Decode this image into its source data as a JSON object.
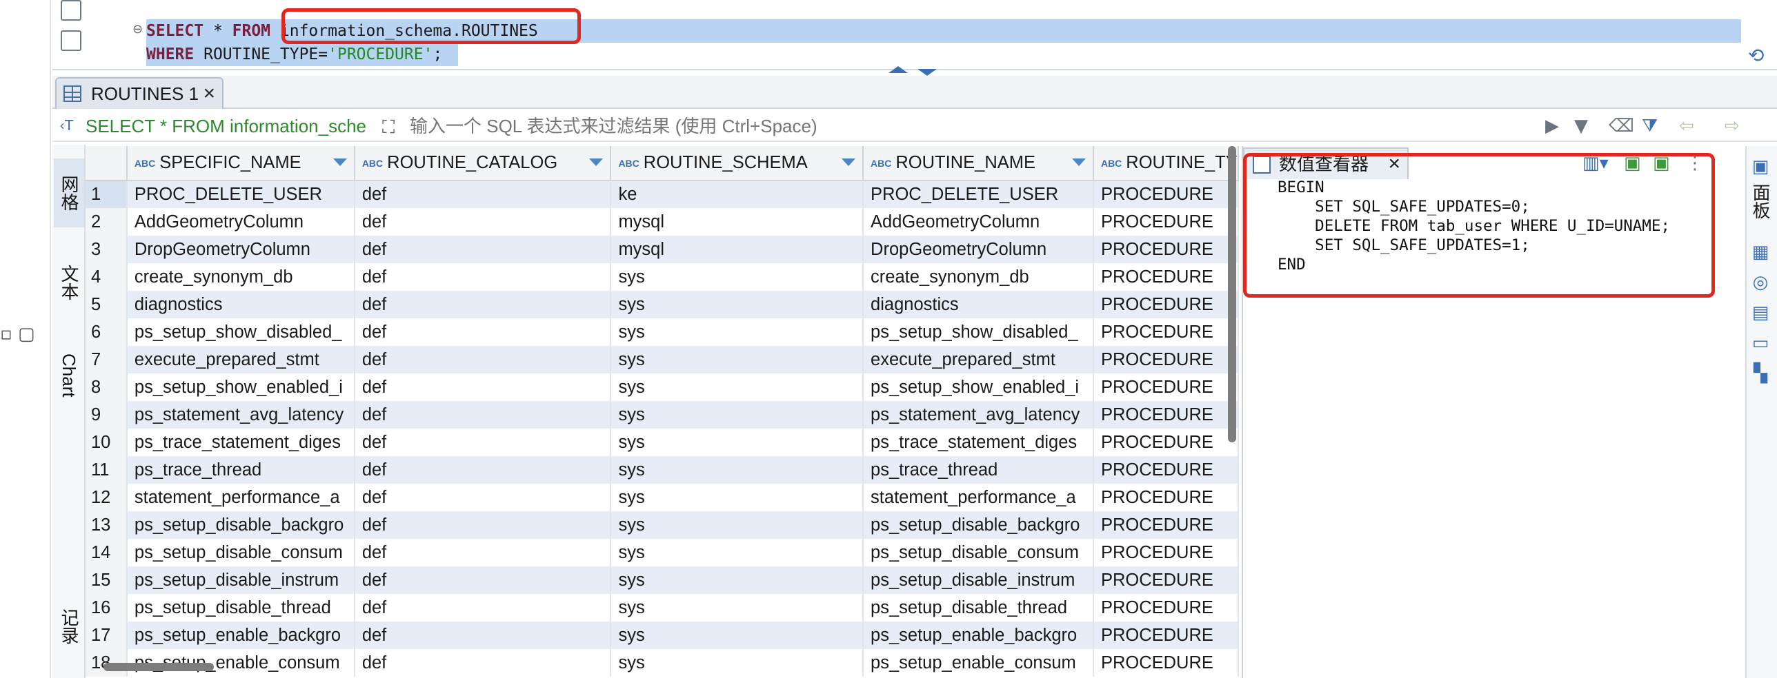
{
  "editor": {
    "line1_select": "SELECT",
    "line1_star": " * ",
    "line1_from": "FROM",
    "line1_table": " information_schema.ROUTINES",
    "line2_where": "WHERE",
    "line2_col": " ROUTINE_TYPE=",
    "line2_value": "'PROCEDURE'",
    "line2_end": ";"
  },
  "tabs": {
    "results_label": "ROUTINES 1"
  },
  "filter": {
    "sql_text": "SELECT * FROM information_sche",
    "placeholder": "输入一个 SQL 表达式来过滤结果 (使用 Ctrl+Space)"
  },
  "side_tabs": {
    "grid": "网格",
    "text": "文本",
    "chart": "Chart",
    "records": "记录"
  },
  "grid": {
    "columns": [
      "SPECIFIC_NAME",
      "ROUTINE_CATALOG",
      "ROUTINE_SCHEMA",
      "ROUTINE_NAME",
      "ROUTINE_TY"
    ],
    "rows": [
      [
        "1",
        "PROC_DELETE_USER",
        "def",
        "ke",
        "PROC_DELETE_USER",
        "PROCEDURE"
      ],
      [
        "2",
        "AddGeometryColumn",
        "def",
        "mysql",
        "AddGeometryColumn",
        "PROCEDURE"
      ],
      [
        "3",
        "DropGeometryColumn",
        "def",
        "mysql",
        "DropGeometryColumn",
        "PROCEDURE"
      ],
      [
        "4",
        "create_synonym_db",
        "def",
        "sys",
        "create_synonym_db",
        "PROCEDURE"
      ],
      [
        "5",
        "diagnostics",
        "def",
        "sys",
        "diagnostics",
        "PROCEDURE"
      ],
      [
        "6",
        "ps_setup_show_disabled_",
        "def",
        "sys",
        "ps_setup_show_disabled_",
        "PROCEDURE"
      ],
      [
        "7",
        "execute_prepared_stmt",
        "def",
        "sys",
        "execute_prepared_stmt",
        "PROCEDURE"
      ],
      [
        "8",
        "ps_setup_show_enabled_i",
        "def",
        "sys",
        "ps_setup_show_enabled_i",
        "PROCEDURE"
      ],
      [
        "9",
        "ps_statement_avg_latency",
        "def",
        "sys",
        "ps_statement_avg_latency",
        "PROCEDURE"
      ],
      [
        "10",
        "ps_trace_statement_diges",
        "def",
        "sys",
        "ps_trace_statement_diges",
        "PROCEDURE"
      ],
      [
        "11",
        "ps_trace_thread",
        "def",
        "sys",
        "ps_trace_thread",
        "PROCEDURE"
      ],
      [
        "12",
        "statement_performance_a",
        "def",
        "sys",
        "statement_performance_a",
        "PROCEDURE"
      ],
      [
        "13",
        "ps_setup_disable_backgro",
        "def",
        "sys",
        "ps_setup_disable_backgro",
        "PROCEDURE"
      ],
      [
        "14",
        "ps_setup_disable_consum",
        "def",
        "sys",
        "ps_setup_disable_consum",
        "PROCEDURE"
      ],
      [
        "15",
        "ps_setup_disable_instrum",
        "def",
        "sys",
        "ps_setup_disable_instrum",
        "PROCEDURE"
      ],
      [
        "16",
        "ps_setup_disable_thread",
        "def",
        "sys",
        "ps_setup_disable_thread",
        "PROCEDURE"
      ],
      [
        "17",
        "ps_setup_enable_backgro",
        "def",
        "sys",
        "ps_setup_enable_backgro",
        "PROCEDURE"
      ],
      [
        "18",
        "ps_setup_enable_consum",
        "def",
        "sys",
        "ps_setup_enable_consum",
        "PROCEDURE"
      ]
    ]
  },
  "viewer": {
    "title": "数值查看器",
    "code": "BEGIN\n    SET SQL_SAFE_UPDATES=0;\n    DELETE FROM tab_user WHERE U_ID=UNAME;\n    SET SQL_SAFE_UPDATES=1;\nEND"
  },
  "right_strip": {
    "panels_label": "面板"
  },
  "colors": {
    "highlight_box": "#e0281e",
    "selection": "#b9d3f2",
    "keyword": "#7a1f3d",
    "string": "#1f8a1f",
    "alt_row": "#e6edf6"
  }
}
